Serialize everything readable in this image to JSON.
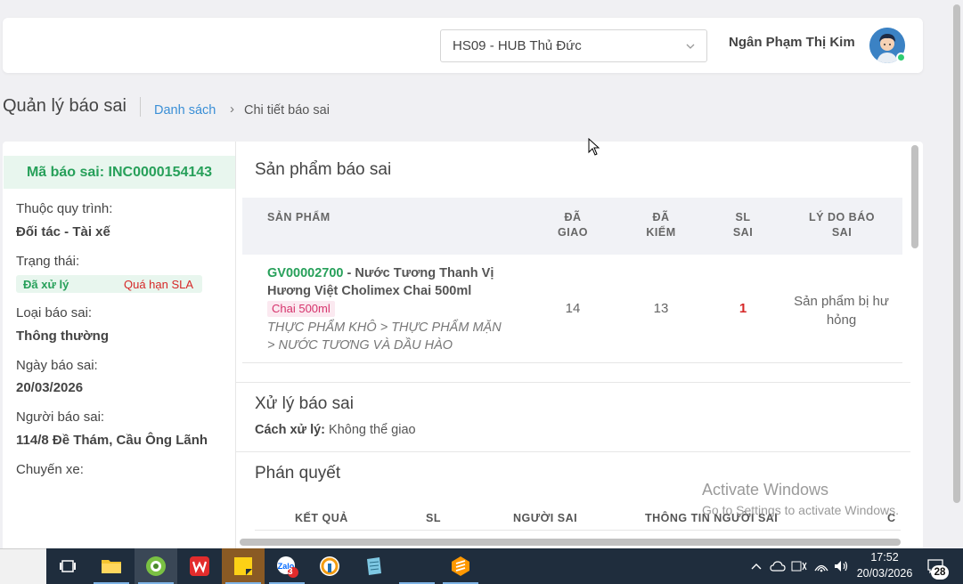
{
  "header": {
    "hub_select": "HS09 - HUB Thủ Đức",
    "user_name": "Ngân Phạm Thị Kim"
  },
  "breadcrumb": {
    "page_title": "Quản lý báo sai",
    "link": "Danh sách",
    "separator": "›",
    "current": "Chi tiết báo sai"
  },
  "detail": {
    "code_label": "Mã báo sai: INC0000154143",
    "fields": [
      {
        "label": "Thuộc quy trình:",
        "value": "Đối tác - Tài xế"
      },
      {
        "label": "Trạng thái:",
        "value": ""
      },
      {
        "label": "Loại báo sai:",
        "value": "Thông thường"
      },
      {
        "label": "Ngày báo sai:",
        "value": "20/03/2026"
      },
      {
        "label": "Người báo sai:",
        "value": "114/8 Đề Thám, Cầu Ông Lãnh"
      },
      {
        "label": "Chuyến xe:",
        "value": ""
      }
    ],
    "status_primary": "Đã xử lý",
    "status_secondary": "Quá hạn SLA"
  },
  "products": {
    "title": "Sản phẩm báo sai",
    "headers": {
      "product": "SẢN PHẨM",
      "delivered_1": "ĐÃ",
      "delivered_2": "GIAO",
      "checked_1": "ĐÃ",
      "checked_2": "KIỂM",
      "wrong_1": "SL",
      "wrong_2": "SAI",
      "reason_1": "LÝ DO BÁO",
      "reason_2": "SAI"
    },
    "row": {
      "code": "GV00002700",
      "name": " - Nước Tương Thanh Vị Hương Việt Cholimex Chai 500ml",
      "tag": "Chai 500ml",
      "category": "THỰC PHẨM KHÔ > THỰC PHẨM MẶN > NƯỚC TƯƠNG VÀ DẦU HÀO",
      "delivered": "14",
      "checked": "13",
      "wrong": "1",
      "reason": "Sản phẩm bị hư hỏng"
    }
  },
  "handling": {
    "title": "Xử lý báo sai",
    "method_label": "Cách xử lý:",
    "method_value": " Không thể giao"
  },
  "verdict": {
    "title": "Phán quyết",
    "headers": [
      "KẾT QUẢ",
      "SL",
      "NGƯỜI SAI",
      "THÔNG TIN NGƯỜI SAI",
      "C"
    ]
  },
  "watermark": {
    "line1": "Activate Windows",
    "line2": "Go to Settings to activate Windows."
  },
  "taskbar": {
    "time": "17:52",
    "date": "20/03/2026",
    "notifications": "28",
    "zalo_badge": "3"
  }
}
